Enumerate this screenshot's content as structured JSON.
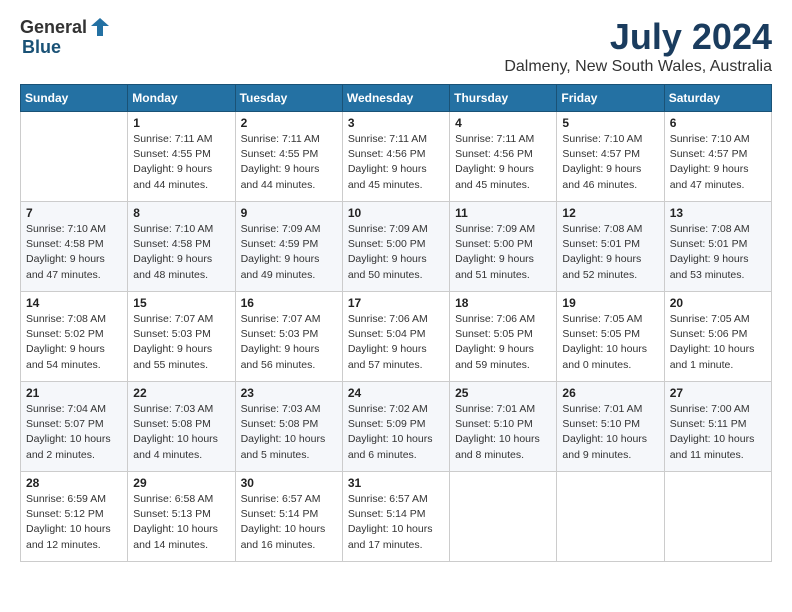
{
  "header": {
    "logo": {
      "general": "General",
      "blue": "Blue"
    },
    "title": "July 2024",
    "subtitle": "Dalmeny, New South Wales, Australia"
  },
  "days_of_week": [
    "Sunday",
    "Monday",
    "Tuesday",
    "Wednesday",
    "Thursday",
    "Friday",
    "Saturday"
  ],
  "weeks": [
    [
      {
        "day": null
      },
      {
        "day": "1",
        "sunrise": "7:11 AM",
        "sunset": "4:55 PM",
        "daylight": "9 hours and 44 minutes."
      },
      {
        "day": "2",
        "sunrise": "7:11 AM",
        "sunset": "4:55 PM",
        "daylight": "9 hours and 44 minutes."
      },
      {
        "day": "3",
        "sunrise": "7:11 AM",
        "sunset": "4:56 PM",
        "daylight": "9 hours and 45 minutes."
      },
      {
        "day": "4",
        "sunrise": "7:11 AM",
        "sunset": "4:56 PM",
        "daylight": "9 hours and 45 minutes."
      },
      {
        "day": "5",
        "sunrise": "7:10 AM",
        "sunset": "4:57 PM",
        "daylight": "9 hours and 46 minutes."
      },
      {
        "day": "6",
        "sunrise": "7:10 AM",
        "sunset": "4:57 PM",
        "daylight": "9 hours and 47 minutes."
      }
    ],
    [
      {
        "day": "7",
        "sunrise": "7:10 AM",
        "sunset": "4:58 PM",
        "daylight": "9 hours and 47 minutes."
      },
      {
        "day": "8",
        "sunrise": "7:10 AM",
        "sunset": "4:58 PM",
        "daylight": "9 hours and 48 minutes."
      },
      {
        "day": "9",
        "sunrise": "7:09 AM",
        "sunset": "4:59 PM",
        "daylight": "9 hours and 49 minutes."
      },
      {
        "day": "10",
        "sunrise": "7:09 AM",
        "sunset": "5:00 PM",
        "daylight": "9 hours and 50 minutes."
      },
      {
        "day": "11",
        "sunrise": "7:09 AM",
        "sunset": "5:00 PM",
        "daylight": "9 hours and 51 minutes."
      },
      {
        "day": "12",
        "sunrise": "7:08 AM",
        "sunset": "5:01 PM",
        "daylight": "9 hours and 52 minutes."
      },
      {
        "day": "13",
        "sunrise": "7:08 AM",
        "sunset": "5:01 PM",
        "daylight": "9 hours and 53 minutes."
      }
    ],
    [
      {
        "day": "14",
        "sunrise": "7:08 AM",
        "sunset": "5:02 PM",
        "daylight": "9 hours and 54 minutes."
      },
      {
        "day": "15",
        "sunrise": "7:07 AM",
        "sunset": "5:03 PM",
        "daylight": "9 hours and 55 minutes."
      },
      {
        "day": "16",
        "sunrise": "7:07 AM",
        "sunset": "5:03 PM",
        "daylight": "9 hours and 56 minutes."
      },
      {
        "day": "17",
        "sunrise": "7:06 AM",
        "sunset": "5:04 PM",
        "daylight": "9 hours and 57 minutes."
      },
      {
        "day": "18",
        "sunrise": "7:06 AM",
        "sunset": "5:05 PM",
        "daylight": "9 hours and 59 minutes."
      },
      {
        "day": "19",
        "sunrise": "7:05 AM",
        "sunset": "5:05 PM",
        "daylight": "10 hours and 0 minutes."
      },
      {
        "day": "20",
        "sunrise": "7:05 AM",
        "sunset": "5:06 PM",
        "daylight": "10 hours and 1 minute."
      }
    ],
    [
      {
        "day": "21",
        "sunrise": "7:04 AM",
        "sunset": "5:07 PM",
        "daylight": "10 hours and 2 minutes."
      },
      {
        "day": "22",
        "sunrise": "7:03 AM",
        "sunset": "5:08 PM",
        "daylight": "10 hours and 4 minutes."
      },
      {
        "day": "23",
        "sunrise": "7:03 AM",
        "sunset": "5:08 PM",
        "daylight": "10 hours and 5 minutes."
      },
      {
        "day": "24",
        "sunrise": "7:02 AM",
        "sunset": "5:09 PM",
        "daylight": "10 hours and 6 minutes."
      },
      {
        "day": "25",
        "sunrise": "7:01 AM",
        "sunset": "5:10 PM",
        "daylight": "10 hours and 8 minutes."
      },
      {
        "day": "26",
        "sunrise": "7:01 AM",
        "sunset": "5:10 PM",
        "daylight": "10 hours and 9 minutes."
      },
      {
        "day": "27",
        "sunrise": "7:00 AM",
        "sunset": "5:11 PM",
        "daylight": "10 hours and 11 minutes."
      }
    ],
    [
      {
        "day": "28",
        "sunrise": "6:59 AM",
        "sunset": "5:12 PM",
        "daylight": "10 hours and 12 minutes."
      },
      {
        "day": "29",
        "sunrise": "6:58 AM",
        "sunset": "5:13 PM",
        "daylight": "10 hours and 14 minutes."
      },
      {
        "day": "30",
        "sunrise": "6:57 AM",
        "sunset": "5:14 PM",
        "daylight": "10 hours and 16 minutes."
      },
      {
        "day": "31",
        "sunrise": "6:57 AM",
        "sunset": "5:14 PM",
        "daylight": "10 hours and 17 minutes."
      },
      {
        "day": null
      },
      {
        "day": null
      },
      {
        "day": null
      }
    ]
  ],
  "labels": {
    "sunrise": "Sunrise:",
    "sunset": "Sunset:",
    "daylight": "Daylight:"
  }
}
